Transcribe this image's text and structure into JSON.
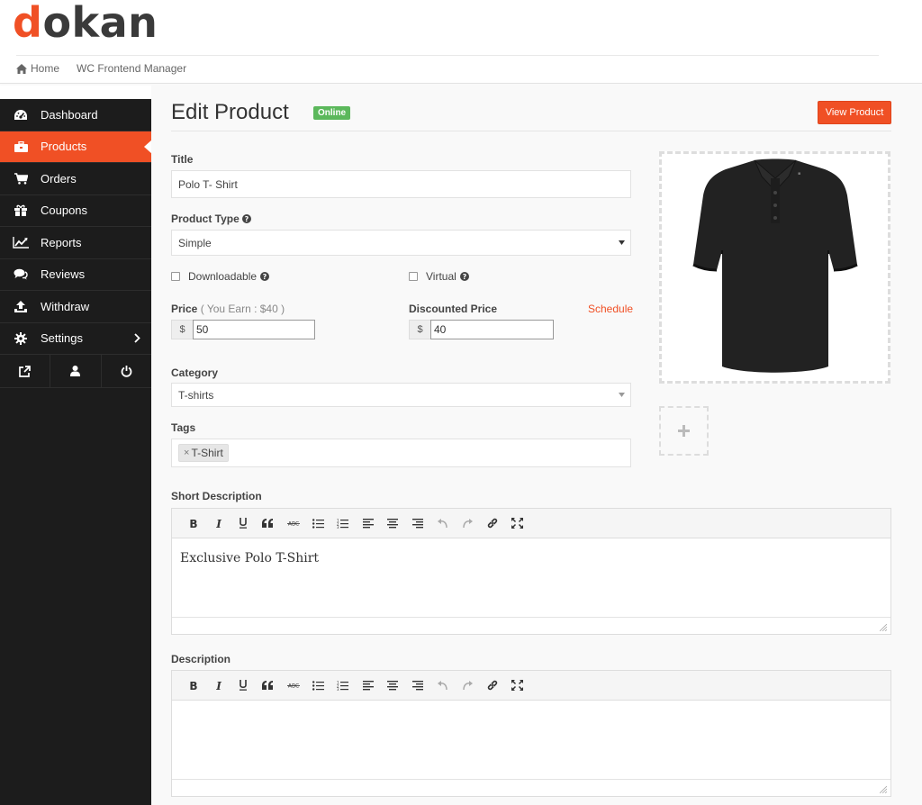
{
  "brand": {
    "logo_first": "d",
    "logo_rest": "okan",
    "accent": "#f05025"
  },
  "breadcrumb": [
    {
      "label": "Home"
    },
    {
      "label": "WC Frontend Manager"
    }
  ],
  "sidebar": {
    "items": [
      {
        "label": "Dashboard",
        "icon": "dashboard-icon"
      },
      {
        "label": "Products",
        "icon": "briefcase-icon",
        "active": true
      },
      {
        "label": "Orders",
        "icon": "cart-icon"
      },
      {
        "label": "Coupons",
        "icon": "gift-icon"
      },
      {
        "label": "Reports",
        "icon": "line-chart-icon"
      },
      {
        "label": "Reviews",
        "icon": "comments-icon"
      },
      {
        "label": "Withdraw",
        "icon": "upload-icon"
      },
      {
        "label": "Settings",
        "icon": "gear-icon"
      }
    ],
    "bottom_icons": [
      "external-link-icon",
      "user-icon",
      "power-icon"
    ]
  },
  "page": {
    "title": "Edit Product",
    "status_badge": "Online",
    "view_button": "View Product"
  },
  "form": {
    "title_label": "Title",
    "title_value": "Polo T- Shirt",
    "product_type_label": "Product Type",
    "product_type_value": "Simple",
    "downloadable_label": "Downloadable",
    "virtual_label": "Virtual",
    "price_label": "Price",
    "price_earn_note": "( You Earn : $40 )",
    "price_currency": "$",
    "price_value": "50",
    "discounted_label": "Discounted Price",
    "discounted_currency": "$",
    "discounted_value": "40",
    "schedule_link": "Schedule",
    "category_label": "Category",
    "category_value": "T-shirts",
    "tags_label": "Tags",
    "tags": [
      "T-Shirt"
    ],
    "short_description_label": "Short Description",
    "short_description_value": "Exclusive Polo T-Shirt",
    "description_label": "Description",
    "description_value": ""
  },
  "editor_tools": [
    "bold",
    "italic",
    "underline",
    "blockquote",
    "strikethrough",
    "bullet-list",
    "numbered-list",
    "align-left",
    "align-center",
    "align-right",
    "undo",
    "redo",
    "link",
    "fullscreen"
  ]
}
